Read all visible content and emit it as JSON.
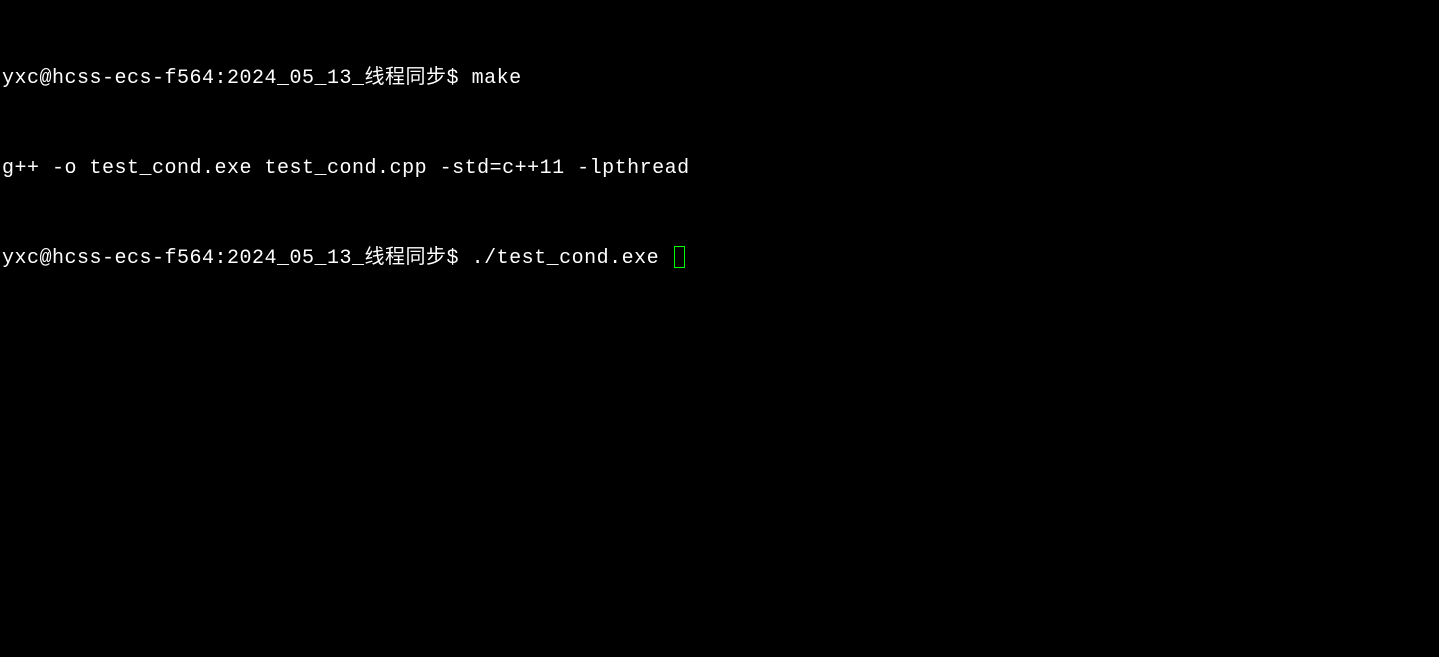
{
  "terminal": {
    "lines": [
      {
        "prompt": "yxc@hcss-ecs-f564:2024_05_13_线程同步$ ",
        "command": "make"
      },
      {
        "output": "g++ -o test_cond.exe test_cond.cpp -std=c++11 -lpthread"
      },
      {
        "prompt": "yxc@hcss-ecs-f564:2024_05_13_线程同步$ ",
        "command": "./test_cond.exe "
      }
    ]
  }
}
